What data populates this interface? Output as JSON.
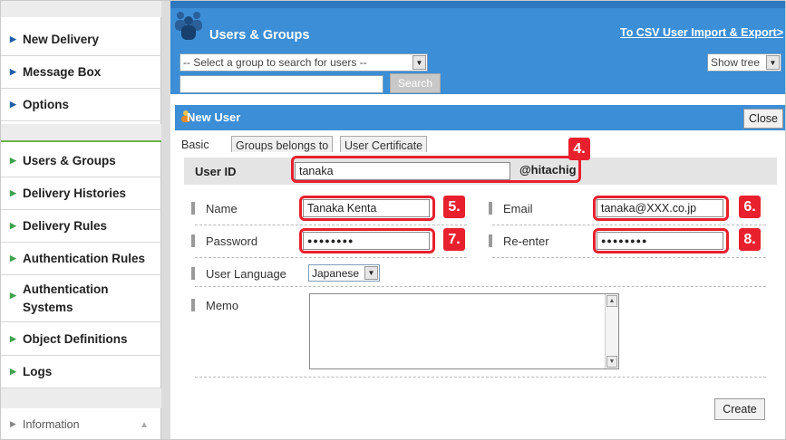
{
  "sidebar": {
    "items": [
      {
        "label": "New Delivery"
      },
      {
        "label": "Message Box"
      },
      {
        "label": "Options"
      },
      {
        "label": "Users & Groups"
      },
      {
        "label": "Delivery Histories"
      },
      {
        "label": "Delivery Rules"
      },
      {
        "label": "Authentication Rules"
      },
      {
        "label": "Authentication Systems"
      },
      {
        "label": "Object Definitions"
      },
      {
        "label": "Logs"
      }
    ],
    "information": "Information"
  },
  "header": {
    "title": "Users & Groups",
    "csv_link": "To CSV User Import & Export>",
    "group_select": "-- Select a group to search for users --",
    "search_value": "",
    "search_button": "Search",
    "show_tree": "Show tree"
  },
  "panel": {
    "title": "New User",
    "close": "Close",
    "tabs": [
      {
        "label": "Basic"
      },
      {
        "label": "Groups belongs to"
      },
      {
        "label": "User Certificate"
      }
    ],
    "form": {
      "user_id_label": "User ID",
      "user_id_value": "tanaka",
      "domain": "@hitachig",
      "name_label": "Name",
      "name_value": "Tanaka Kenta",
      "email_label": "Email",
      "email_value": "tanaka@XXX.co.jp",
      "password_label": "Password",
      "password_value": "●●●●●●●●",
      "reenter_label": "Re-enter",
      "reenter_value": "●●●●●●●●",
      "language_label": "User Language",
      "language_value": "Japanese",
      "memo_label": "Memo",
      "memo_value": "",
      "create_button": "Create"
    },
    "callouts": [
      "4.",
      "5.",
      "6.",
      "7.",
      "8."
    ]
  },
  "colors": {
    "header_blue": "#3c8ed6",
    "callout_red": "#e8202e",
    "nav_triangle_blue": "#1f5fa8",
    "nav_triangle_green": "#3fa34d"
  }
}
